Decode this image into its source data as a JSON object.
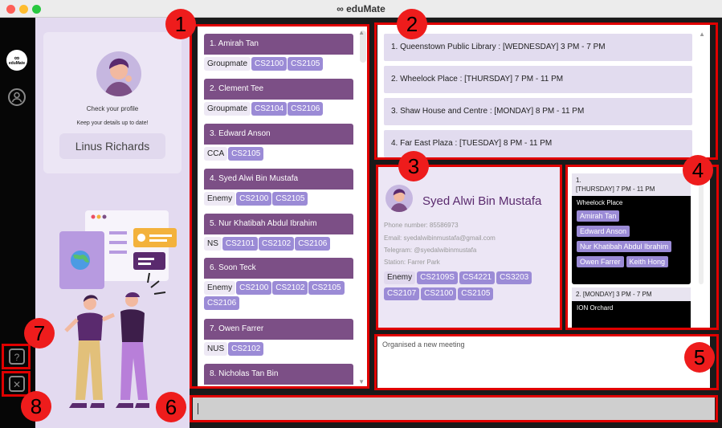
{
  "window": {
    "title": "∞ eduMate",
    "dot_colors": [
      "#fe5f57",
      "#febc2e",
      "#28c840"
    ]
  },
  "sidebar": {
    "logo_text": "eduMate",
    "profile_icon": "person-icon",
    "help_icon": "question-icon",
    "exit_icon": "close-icon"
  },
  "profile_panel": {
    "check_label": "Check your profile",
    "keep_label": "Keep your details up to date!",
    "user_name": "Linus Richards"
  },
  "contacts": [
    {
      "index_name": "1.    Amirah Tan",
      "tags": [
        "Groupmate"
      ],
      "modules": [
        "CS2100",
        "CS2105"
      ]
    },
    {
      "index_name": "2.    Clement Tee",
      "tags": [
        "Groupmate"
      ],
      "modules": [
        "CS2104",
        "CS2106"
      ]
    },
    {
      "index_name": "3.    Edward Anson",
      "tags": [
        "CCA"
      ],
      "modules": [
        "CS2105"
      ]
    },
    {
      "index_name": "4.    Syed Alwi Bin Mustafa",
      "tags": [
        "Enemy"
      ],
      "modules": [
        "CS2100",
        "CS2105"
      ]
    },
    {
      "index_name": "5.    Nur Khatibah Abdul Ibrahim",
      "tags": [
        "NS"
      ],
      "modules": [
        "CS2101",
        "CS2102",
        "CS2106"
      ]
    },
    {
      "index_name": "6.    Soon Teck",
      "tags": [
        "Enemy"
      ],
      "modules": [
        "CS2100",
        "CS2102",
        "CS2105",
        "CS2106"
      ]
    },
    {
      "index_name": "7.    Owen Farrer",
      "tags": [
        "NUS"
      ],
      "modules": [
        "CS2102"
      ]
    },
    {
      "index_name": "8.    Nicholas Tan Bin",
      "tags": [],
      "modules": []
    }
  ],
  "locations": [
    "1.     Queenstown Public Library : [WEDNESDAY] 3 PM - 7 PM",
    "2.     Wheelock Place : [THURSDAY] 7 PM - 11 PM",
    "3.     Shaw House and Centre : [MONDAY] 8 PM - 11 PM",
    "4.     Far East Plaza : [TUESDAY] 8 PM - 11 PM"
  ],
  "person_detail": {
    "name": "Syed Alwi Bin Mustafa",
    "phone": "Phone number: 85586973",
    "email": "Email: syedalwibinmustafa@gmail.com",
    "telegram": "Telegram: @syedalwibinmustafa",
    "station": "Station: Farrer Park",
    "tag": "Enemy",
    "modules": [
      "CS2109S",
      "CS4221",
      "CS3203",
      "CS2107",
      "CS2100",
      "CS2105"
    ]
  },
  "meetings": [
    {
      "header_index": "1.",
      "header_time": "[THURSDAY] 7 PM - 11 PM",
      "location": "Wheelock Place",
      "participants": [
        "Amirah Tan",
        "Edward Anson",
        "Nur Khatibah Abdul Ibrahim",
        "Owen Farrer",
        "Keith Hong"
      ]
    },
    {
      "header_text": "2. [MONDAY] 3 PM - 7 PM",
      "location": "ION Orchard"
    }
  ],
  "result_text": "Organised a new meeting",
  "command": {
    "value": ""
  },
  "callouts": [
    "1",
    "2",
    "3",
    "4",
    "5",
    "6",
    "7",
    "8"
  ],
  "colors": {
    "annotation": "#e00000",
    "callout_fill": "#ee1c1c",
    "accent": "#7c4f86",
    "module_tag": "#9b8bd6"
  }
}
